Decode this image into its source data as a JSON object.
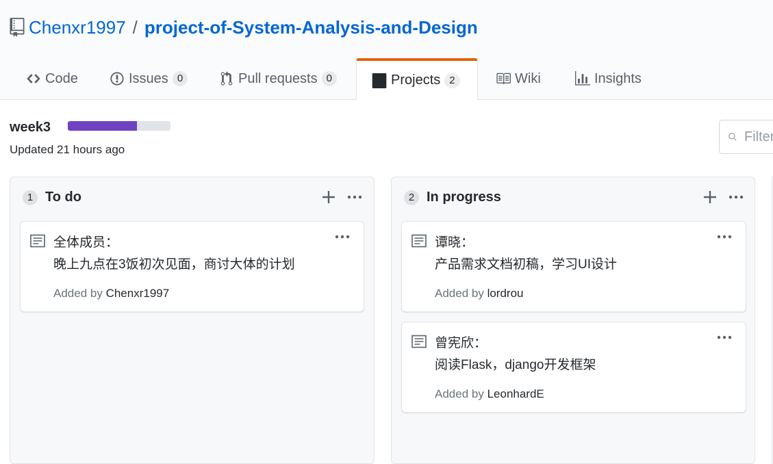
{
  "repo": {
    "owner": "Chenxr1997",
    "separator": "/",
    "name": "project-of-System-Analysis-and-Design",
    "icon": "repo-book-icon"
  },
  "tabs": [
    {
      "label": "Code",
      "icon": "code-icon",
      "counter": null,
      "selected": false
    },
    {
      "label": "Issues",
      "icon": "issue-opened-icon",
      "counter": "0",
      "selected": false
    },
    {
      "label": "Pull requests",
      "icon": "git-pull-request-icon",
      "counter": "0",
      "selected": false
    },
    {
      "label": "Projects",
      "icon": "project-icon",
      "counter": "2",
      "selected": true
    },
    {
      "label": "Wiki",
      "icon": "book-icon",
      "counter": null,
      "selected": false
    },
    {
      "label": "Insights",
      "icon": "graph-icon",
      "counter": null,
      "selected": false
    }
  ],
  "project": {
    "name": "week3",
    "progress_fraction": 0.67,
    "progress_color": "#6f42c1",
    "updated": "Updated 21 hours ago",
    "filter_placeholder": "Filter cards"
  },
  "columns": [
    {
      "count": "1",
      "name": "To do",
      "cards": [
        {
          "line1": "全体成员：",
          "line2": "晚上九点在3饭初次见面，商讨大体的计划",
          "added_prefix": "Added by",
          "user": "Chenxr1997"
        }
      ]
    },
    {
      "count": "2",
      "name": "In progress",
      "cards": [
        {
          "line1": "谭晓：",
          "line2": "产品需求文档初稿，学习UI设计",
          "added_prefix": "Added by",
          "user": "lordrou"
        },
        {
          "line1": "曾宪欣：",
          "line2": "阅读Flask，django开发框架",
          "added_prefix": "Added by",
          "user": "LeonhardE"
        }
      ]
    }
  ],
  "colors": {
    "link": "#0366d6",
    "tab_accent": "#e36209",
    "column_bg": "#f6f8fa"
  }
}
